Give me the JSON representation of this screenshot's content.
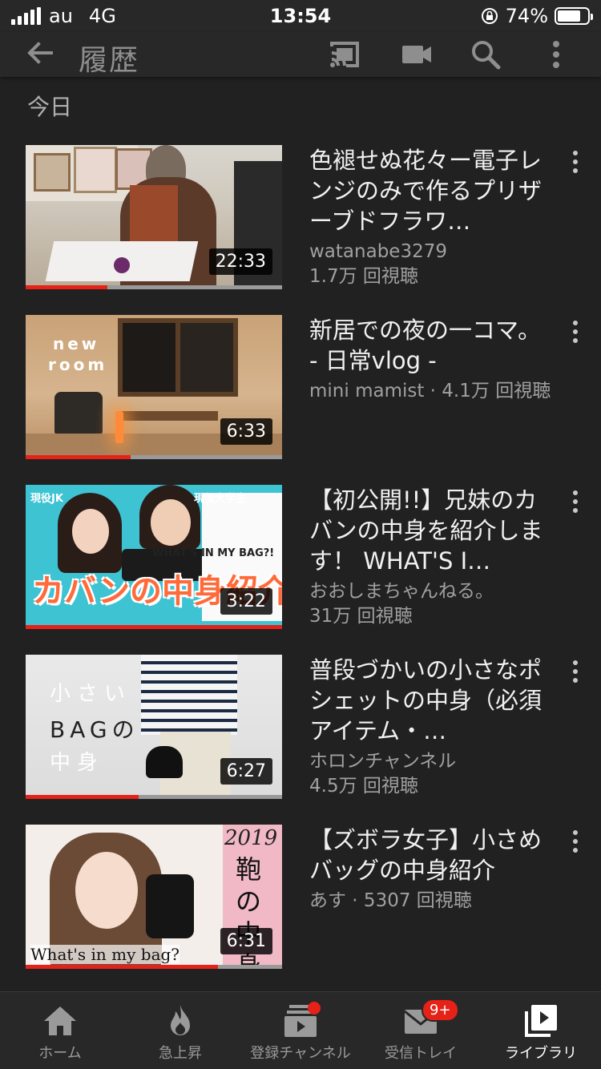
{
  "status_bar": {
    "carrier": "au",
    "network": "4G",
    "time": "13:54",
    "battery": "74%"
  },
  "app_bar": {
    "title": "履歴",
    "icons": [
      "back-arrow-icon",
      "cast-icon",
      "camera-icon",
      "search-icon",
      "more-vert-icon"
    ]
  },
  "section": {
    "header": "今日"
  },
  "videos": [
    {
      "title": "色褪せぬ花々ー電子レンジのみで作るプリザーブドフラワ…",
      "channel": "watanabe3279",
      "views": "1.7万 回視聴",
      "duration": "22:33",
      "progress": 0.32
    },
    {
      "title": "新居での夜の一コマ。 - 日常vlog -",
      "meta": "mini mamist · 4.1万 回視聴",
      "duration": "6:33",
      "progress": 0.41,
      "thumb_text": [
        "new",
        "room"
      ]
    },
    {
      "title": "【初公開!!】兄妹のカバンの中身を紹介します！ WHAT'S I…",
      "channel": "おおしまちゃんねる。",
      "views": "31万 回視聴",
      "duration": "3:22",
      "progress": 1.0,
      "thumb_text": [
        "現役JK",
        "現役大学生",
        "WHAT'S IN MY BAG?!",
        "カバンの中身紹介!"
      ]
    },
    {
      "title": "普段づかいの小さなポシェットの中身（必須アイテム・…",
      "channel": "ホロンチャンネル",
      "views": "4.5万 回視聴",
      "duration": "6:27",
      "progress": 0.44,
      "thumb_text": [
        "小さい",
        "BAGの",
        "中身"
      ]
    },
    {
      "title": "【ズボラ女子】小さめバッグの中身紹介",
      "meta": "あす · 5307 回視聴",
      "duration": "6:31",
      "progress": 0.75,
      "thumb_text": [
        "2019",
        "鞄の中身",
        "What's in my bag?"
      ]
    }
  ],
  "bottom_nav": {
    "items": [
      {
        "label": "ホーム",
        "icon": "home-icon"
      },
      {
        "label": "急上昇",
        "icon": "trending-flame-icon"
      },
      {
        "label": "登録チャンネル",
        "icon": "subscriptions-icon"
      },
      {
        "label": "受信トレイ",
        "icon": "inbox-icon",
        "badge": "9+"
      },
      {
        "label": "ライブラリ",
        "icon": "library-icon",
        "active": true
      }
    ]
  },
  "colors": {
    "background": "#212121",
    "bar": "#282828",
    "accent_red": "#e62117",
    "secondary_text": "#a0a0a0"
  }
}
